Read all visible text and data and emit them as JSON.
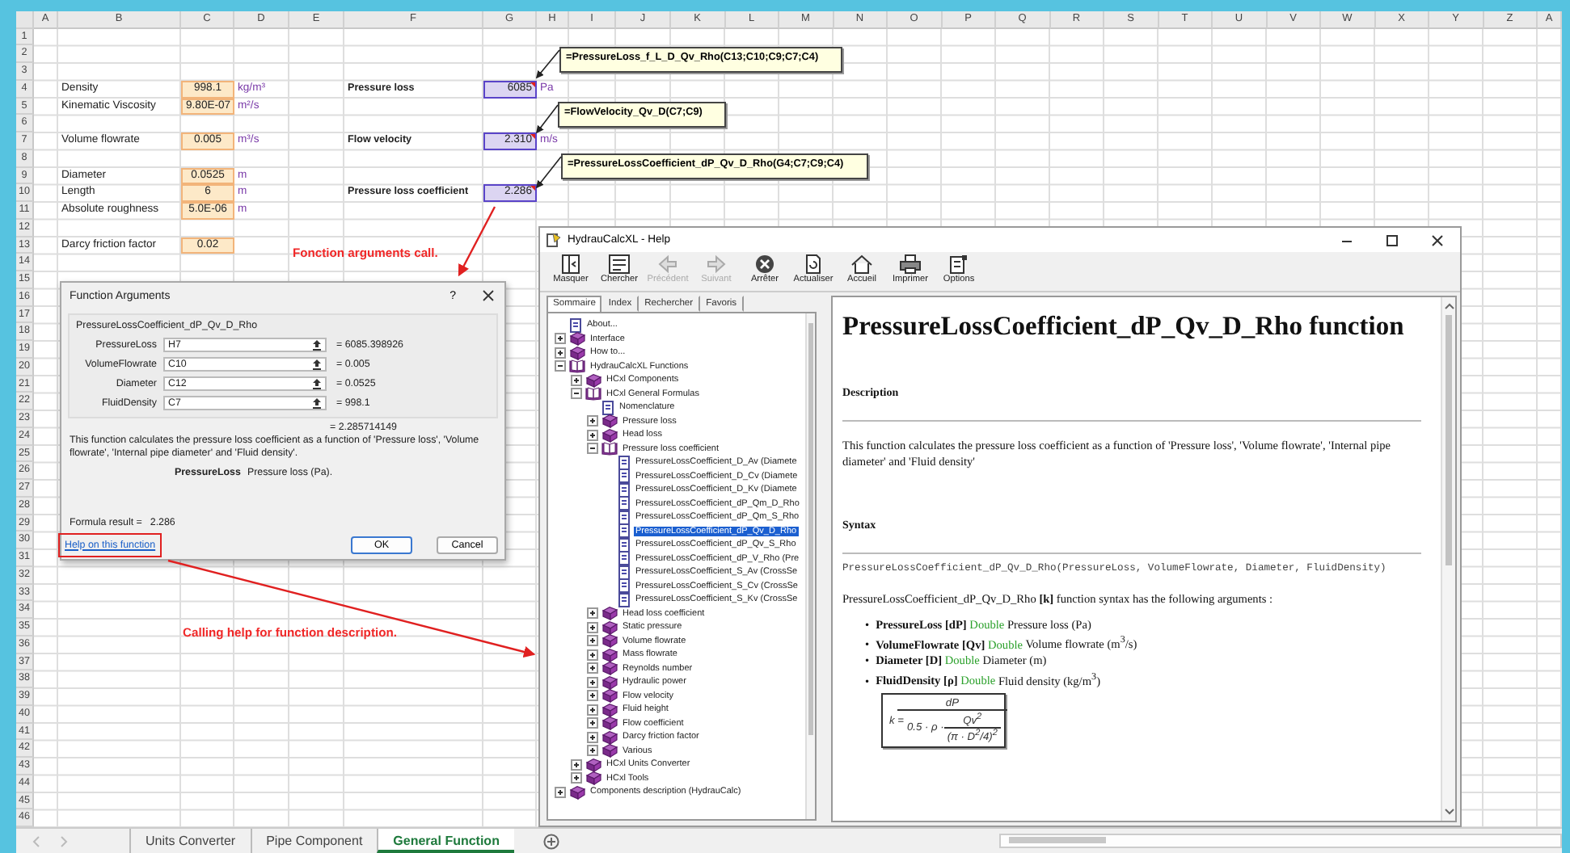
{
  "sheet": {
    "columns": [
      "A",
      "B",
      "C",
      "D",
      "E",
      "F",
      "G",
      "H",
      "I",
      "J",
      "K",
      "L",
      "M",
      "N",
      "O",
      "P",
      "Q",
      "R",
      "S",
      "T",
      "U",
      "V",
      "W",
      "X",
      "Y",
      "Z",
      "A"
    ],
    "rows": [
      {
        "number": "1"
      },
      {
        "number": "2"
      },
      {
        "number": "3"
      },
      {
        "number": "4",
        "B": "Density",
        "C": "998.1",
        "D": "kg/m³",
        "F": "Pressure loss",
        "G": "6085",
        "H": "Pa"
      },
      {
        "number": "5",
        "B": "Kinematic Viscosity",
        "C": "9.80E-07",
        "D": "m²/s"
      },
      {
        "number": "6"
      },
      {
        "number": "7",
        "B": "Volume flowrate",
        "C": "0.005",
        "D": "m³/s",
        "F": "Flow velocity",
        "G": "2.310",
        "H": "m/s"
      },
      {
        "number": "8"
      },
      {
        "number": "9",
        "B": "Diameter",
        "C": "0.0525",
        "D": "m"
      },
      {
        "number": "10",
        "B": "Length",
        "C": "6",
        "D": "m",
        "F": "Pressure loss coefficient",
        "G": "2.286"
      },
      {
        "number": "11",
        "B": "Absolute roughness",
        "C": "5.0E-06",
        "D": "m"
      },
      {
        "number": "12"
      },
      {
        "number": "13",
        "B": "Darcy friction factor",
        "C": "0.02"
      },
      {
        "number": "14"
      },
      {
        "number": "15"
      },
      {
        "number": "16"
      },
      {
        "number": "17"
      },
      {
        "number": "18"
      },
      {
        "number": "19"
      },
      {
        "number": "20"
      },
      {
        "number": "21"
      },
      {
        "number": "22"
      },
      {
        "number": "23"
      },
      {
        "number": "24"
      },
      {
        "number": "25"
      },
      {
        "number": "26"
      },
      {
        "number": "27"
      },
      {
        "number": "28"
      },
      {
        "number": "29"
      },
      {
        "number": "30"
      },
      {
        "number": "31"
      },
      {
        "number": "32"
      },
      {
        "number": "33"
      },
      {
        "number": "34"
      },
      {
        "number": "35"
      },
      {
        "number": "36"
      },
      {
        "number": "37"
      },
      {
        "number": "38"
      },
      {
        "number": "39"
      },
      {
        "number": "40"
      },
      {
        "number": "41"
      },
      {
        "number": "42"
      },
      {
        "number": "43"
      },
      {
        "number": "44"
      },
      {
        "number": "45"
      },
      {
        "number": "46"
      }
    ]
  },
  "annotations": [
    {
      "text": "Fonction arguments call."
    },
    {
      "text": "Calling help for function description."
    }
  ],
  "callouts": [
    {
      "text": "=PressureLoss_f_L_D_Qv_Rho(C13;C10;C9;C7;C4)"
    },
    {
      "text": "=FlowVelocity_Qv_D(C7;C9)"
    },
    {
      "text": "=PressureLossCoefficient_dP_Qv_D_Rho(G4;C7;C9;C4)"
    }
  ],
  "dialog": {
    "title": "Function Arguments",
    "help_button": "?",
    "function_name": "PressureLossCoefficient_dP_Qv_D_Rho",
    "arguments": [
      {
        "label": "PressureLoss",
        "value": "H7",
        "result": "= 6085.398926"
      },
      {
        "label": "VolumeFlowrate",
        "value": "C10",
        "result": "= 0.005"
      },
      {
        "label": "Diameter",
        "value": "C12",
        "result": "= 0.0525"
      },
      {
        "label": "FluidDensity",
        "value": "C7",
        "result": "= 998.1"
      }
    ],
    "result": "= 2.285714149",
    "description": "This function calculates the pressure loss coefficient as a function of 'Pressure loss', 'Volume flowrate', 'Internal pipe diameter' and 'Fluid density'.",
    "argument_name": "PressureLoss",
    "argument_description": "Pressure loss (Pa).",
    "formula_result_label": "Formula result =",
    "formula_result": "2.286",
    "help_link": "Help on this function",
    "buttons": [
      "OK",
      "Cancel"
    ]
  },
  "help": {
    "title": "HydrauCalcXL - Help",
    "toolbar": [
      {
        "label": "Masquer",
        "disabled": false
      },
      {
        "label": "Chercher",
        "disabled": false
      },
      {
        "label": "Précédent",
        "disabled": true
      },
      {
        "label": "Suivant",
        "disabled": true
      },
      {
        "label": "Arrêter",
        "disabled": false
      },
      {
        "label": "Actualiser",
        "disabled": false
      },
      {
        "label": "Accueil",
        "disabled": false
      },
      {
        "label": "Imprimer",
        "disabled": false
      },
      {
        "label": "Options",
        "disabled": false
      }
    ],
    "tabs": [
      {
        "label": "Sommaire",
        "selected": true
      },
      {
        "label": "Index",
        "selected": false
      },
      {
        "label": "Rechercher",
        "selected": false
      },
      {
        "label": "Favoris",
        "selected": false
      }
    ],
    "tree": [
      {
        "label": "About...",
        "kind": "page",
        "selected": false
      },
      {
        "label": "Interface",
        "kind": "book",
        "expanded": false,
        "selected": false
      },
      {
        "label": "How to...",
        "kind": "book",
        "expanded": false,
        "selected": false
      },
      {
        "label": "HydrauCalcXL Functions",
        "kind": "book",
        "expanded": true,
        "selected": false,
        "children": [
          {
            "label": "HCxl Components",
            "kind": "book",
            "expanded": false,
            "selected": false
          },
          {
            "label": "HCxl General Formulas",
            "kind": "book",
            "expanded": true,
            "selected": false,
            "children": [
              {
                "label": "Nomenclature",
                "kind": "page",
                "selected": false
              },
              {
                "label": "Pressure loss",
                "kind": "book",
                "expanded": false,
                "selected": false
              },
              {
                "label": "Head loss",
                "kind": "book",
                "expanded": false,
                "selected": false
              },
              {
                "label": "Pressure loss coefficient",
                "kind": "book",
                "expanded": true,
                "selected": false,
                "children": [
                  {
                    "label": "PressureLossCoefficient_D_Av (Diamete",
                    "kind": "page",
                    "selected": false
                  },
                  {
                    "label": "PressureLossCoefficient_D_Cv (Diamete",
                    "kind": "page",
                    "selected": false
                  },
                  {
                    "label": "PressureLossCoefficient_D_Kv (Diamete",
                    "kind": "page",
                    "selected": false
                  },
                  {
                    "label": "PressureLossCoefficient_dP_Qm_D_Rho",
                    "kind": "page",
                    "selected": false
                  },
                  {
                    "label": "PressureLossCoefficient_dP_Qm_S_Rho",
                    "kind": "page",
                    "selected": false
                  },
                  {
                    "label": "PressureLossCoefficient_dP_Qv_D_Rho",
                    "kind": "page",
                    "selected": true
                  },
                  {
                    "label": "PressureLossCoefficient_dP_Qv_S_Rho",
                    "kind": "page",
                    "selected": false
                  },
                  {
                    "label": "PressureLossCoefficient_dP_V_Rho (Pre",
                    "kind": "page",
                    "selected": false
                  },
                  {
                    "label": "PressureLossCoefficient_S_Av (CrossSe",
                    "kind": "page",
                    "selected": false
                  },
                  {
                    "label": "PressureLossCoefficient_S_Cv (CrossSe",
                    "kind": "page",
                    "selected": false
                  },
                  {
                    "label": "PressureLossCoefficient_S_Kv (CrossSe",
                    "kind": "page",
                    "selected": false
                  }
                ]
              },
              {
                "label": "Head loss coefficient",
                "kind": "book",
                "expanded": false,
                "selected": false
              },
              {
                "label": "Static pressure",
                "kind": "book",
                "expanded": false,
                "selected": false
              },
              {
                "label": "Volume flowrate",
                "kind": "book",
                "expanded": false,
                "selected": false
              },
              {
                "label": "Mass flowrate",
                "kind": "book",
                "expanded": false,
                "selected": false
              },
              {
                "label": "Reynolds number",
                "kind": "book",
                "expanded": false,
                "selected": false
              },
              {
                "label": "Hydraulic power",
                "kind": "book",
                "expanded": false,
                "selected": false
              },
              {
                "label": "Flow velocity",
                "kind": "book",
                "expanded": false,
                "selected": false
              },
              {
                "label": "Fluid height",
                "kind": "book",
                "expanded": false,
                "selected": false
              },
              {
                "label": "Flow coefficient",
                "kind": "book",
                "expanded": false,
                "selected": false
              },
              {
                "label": "Darcy friction factor",
                "kind": "book",
                "expanded": false,
                "selected": false
              },
              {
                "label": "Various",
                "kind": "book",
                "expanded": false,
                "selected": false
              }
            ]
          },
          {
            "label": "HCxl Units Converter",
            "kind": "book",
            "expanded": false,
            "selected": false
          },
          {
            "label": "HCxl Tools",
            "kind": "book",
            "expanded": false,
            "selected": false
          }
        ]
      },
      {
        "label": "Components description (HydrauCalc)",
        "kind": "book",
        "expanded": false,
        "selected": false
      }
    ],
    "content": {
      "heading": "PressureLossCoefficient_dP_Qv_D_Rho function",
      "description_heading": "Description",
      "description": "This function calculates the pressure loss coefficient as a function of 'Pressure loss', 'Volume flowrate', 'Internal pipe diameter' and 'Fluid density'",
      "syntax_heading": "Syntax",
      "syntax": "PressureLossCoefficient_dP_Qv_D_Rho(PressureLoss, VolumeFlowrate, Diameter, FluidDensity)",
      "syntax_note": "PressureLossCoefficient_dP_Qv_D_Rho **[k]** function syntax has the following arguments :",
      "arguments": [
        {
          "marker": "•",
          "name": "PressureLoss [dP]",
          "type": "Double",
          "description": "Pressure loss (Pa)"
        },
        {
          "marker": "•",
          "name": "VolumeFlowrate [Qv]",
          "type": "Double",
          "description": "Volume flowrate (m$^{3}$/s)"
        },
        {
          "marker": "•",
          "name": "Diameter [D]",
          "type": "Double",
          "description": "Diameter (m)"
        },
        {
          "marker": "•",
          "name": "FluidDensity [ρ]",
          "type": "Double",
          "description": "Fluid density (kg/m$^{3}$)"
        }
      ],
      "formula": {
        "lhs": "k =",
        "numerator": "dP",
        "factor": "0.5 · ρ ·",
        "inner_numerator": "Qv$^{2}$",
        "inner_denominator": "(π · D$^{2}$/4)$^{2}$"
      }
    }
  },
  "sheet_tabs": [
    {
      "label": "Units Converter",
      "selected": false
    },
    {
      "label": "Pipe Component",
      "selected": false
    },
    {
      "label": "General Function",
      "selected": true
    }
  ]
}
